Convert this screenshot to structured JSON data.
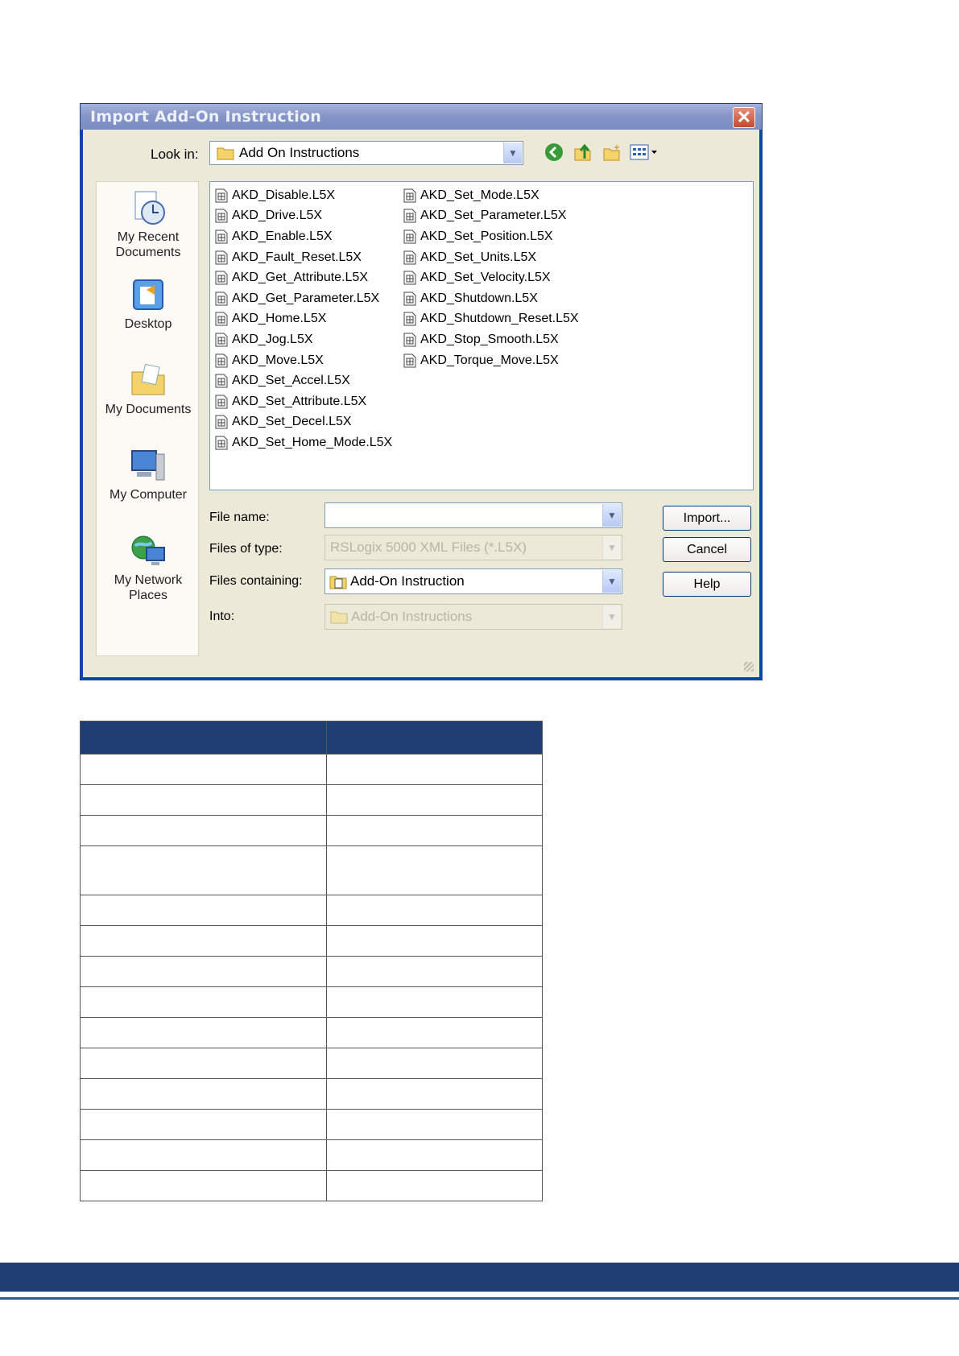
{
  "dialog": {
    "title": "Import Add-On Instruction",
    "look_in_label": "Look in:",
    "look_in_value": "Add On Instructions",
    "places": [
      {
        "label": "My Recent Documents",
        "icon": "recent-documents-icon"
      },
      {
        "label": "Desktop",
        "icon": "desktop-icon"
      },
      {
        "label": "My Documents",
        "icon": "my-documents-icon"
      },
      {
        "label": "My Computer",
        "icon": "my-computer-icon"
      },
      {
        "label": "My Network Places",
        "icon": "network-places-icon"
      }
    ],
    "files_col1": [
      "AKD_Disable.L5X",
      "AKD_Drive.L5X",
      "AKD_Enable.L5X",
      "AKD_Fault_Reset.L5X",
      "AKD_Get_Attribute.L5X",
      "AKD_Get_Parameter.L5X",
      "AKD_Home.L5X",
      "AKD_Jog.L5X",
      "AKD_Move.L5X",
      "AKD_Set_Accel.L5X",
      "AKD_Set_Attribute.L5X",
      "AKD_Set_Decel.L5X",
      "AKD_Set_Home_Mode.L5X"
    ],
    "files_col2": [
      "AKD_Set_Mode.L5X",
      "AKD_Set_Parameter.L5X",
      "AKD_Set_Position.L5X",
      "AKD_Set_Units.L5X",
      "AKD_Set_Velocity.L5X",
      "AKD_Shutdown.L5X",
      "AKD_Shutdown_Reset.L5X",
      "AKD_Stop_Smooth.L5X",
      "AKD_Torque_Move.L5X"
    ],
    "file_name_label": "File name:",
    "file_name_value": "",
    "files_of_type_label": "Files of type:",
    "files_of_type_value": "RSLogix 5000 XML Files (*.L5X)",
    "files_containing_label": "Files containing:",
    "files_containing_value": "Add-On Instruction",
    "into_label": "Into:",
    "into_value": "Add-On Instructions",
    "import_label": "Import...",
    "cancel_label": "Cancel",
    "help_label": "Help"
  },
  "colors": {
    "header_navy": "#1f3f73",
    "footer_line": "#2f5c95"
  }
}
